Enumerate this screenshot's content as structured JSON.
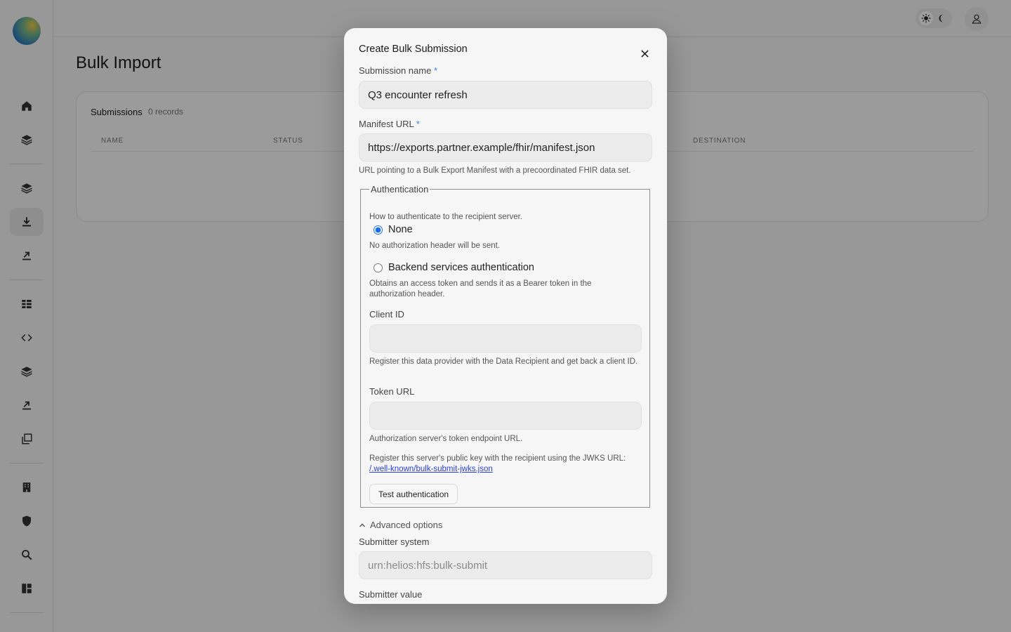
{
  "sidebar": {
    "items": [
      {
        "name": "home-icon"
      },
      {
        "name": "layers-icon"
      },
      {
        "name": "layers-icon"
      },
      {
        "name": "download-icon"
      },
      {
        "name": "upload-icon"
      },
      {
        "name": "grid-icon"
      },
      {
        "name": "code-icon"
      },
      {
        "name": "layers-icon"
      },
      {
        "name": "upload-icon"
      },
      {
        "name": "copy-icon"
      },
      {
        "name": "building-icon"
      },
      {
        "name": "shield-icon"
      },
      {
        "name": "search-icon"
      },
      {
        "name": "dashboard-icon"
      }
    ],
    "active_item": "download-icon"
  },
  "topbar": {
    "theme_light_icon": "sun-icon",
    "theme_dark_icon": "moon-icon",
    "user_icon": "user-icon"
  },
  "page": {
    "title": "Bulk Import",
    "card": {
      "title": "Submissions",
      "count": "0 records",
      "columns": [
        "NAME",
        "STATUS",
        "DESTINATION"
      ]
    }
  },
  "modal": {
    "title": "Create Bulk Submission",
    "close_icon": "close-icon",
    "submission_name": {
      "label": "Submission name",
      "required_mark": "*",
      "value": "Q3 encounter refresh"
    },
    "manifest_url": {
      "label": "Manifest URL",
      "required_mark": "*",
      "value": "https://exports.partner.example/fhir/manifest.json",
      "help": "URL pointing to a Bulk Export Manifest with a precoordinated FHIR data set."
    },
    "authentication": {
      "legend": "Authentication",
      "description": "How to authenticate to the recipient server.",
      "option_none": {
        "label": "None",
        "help": "No authorization header will be sent.",
        "checked": true
      },
      "option_backend": {
        "label": "Backend services authentication",
        "help": "Obtains an access token and sends it as a Bearer token in the authorization header.",
        "checked": false
      },
      "client_id": {
        "label": "Client ID",
        "value": "",
        "help": "Register this data provider with the Data Recipient and get back a client ID."
      },
      "token_url": {
        "label": "Token URL",
        "value": "",
        "help": "Authorization server's token endpoint URL."
      },
      "jwks_text": "Register this server's public key with the recipient using the JWKS URL:",
      "jwks_link": "/.well-known/bulk-submit-jwks.json",
      "test_button": "Test authentication"
    },
    "advanced": {
      "toggle_label": "Advanced options",
      "expanded": true,
      "submitter_system": {
        "label": "Submitter system",
        "placeholder": "urn:helios:hfs:bulk-submit"
      },
      "submitter_value": {
        "label": "Submitter value"
      }
    }
  }
}
